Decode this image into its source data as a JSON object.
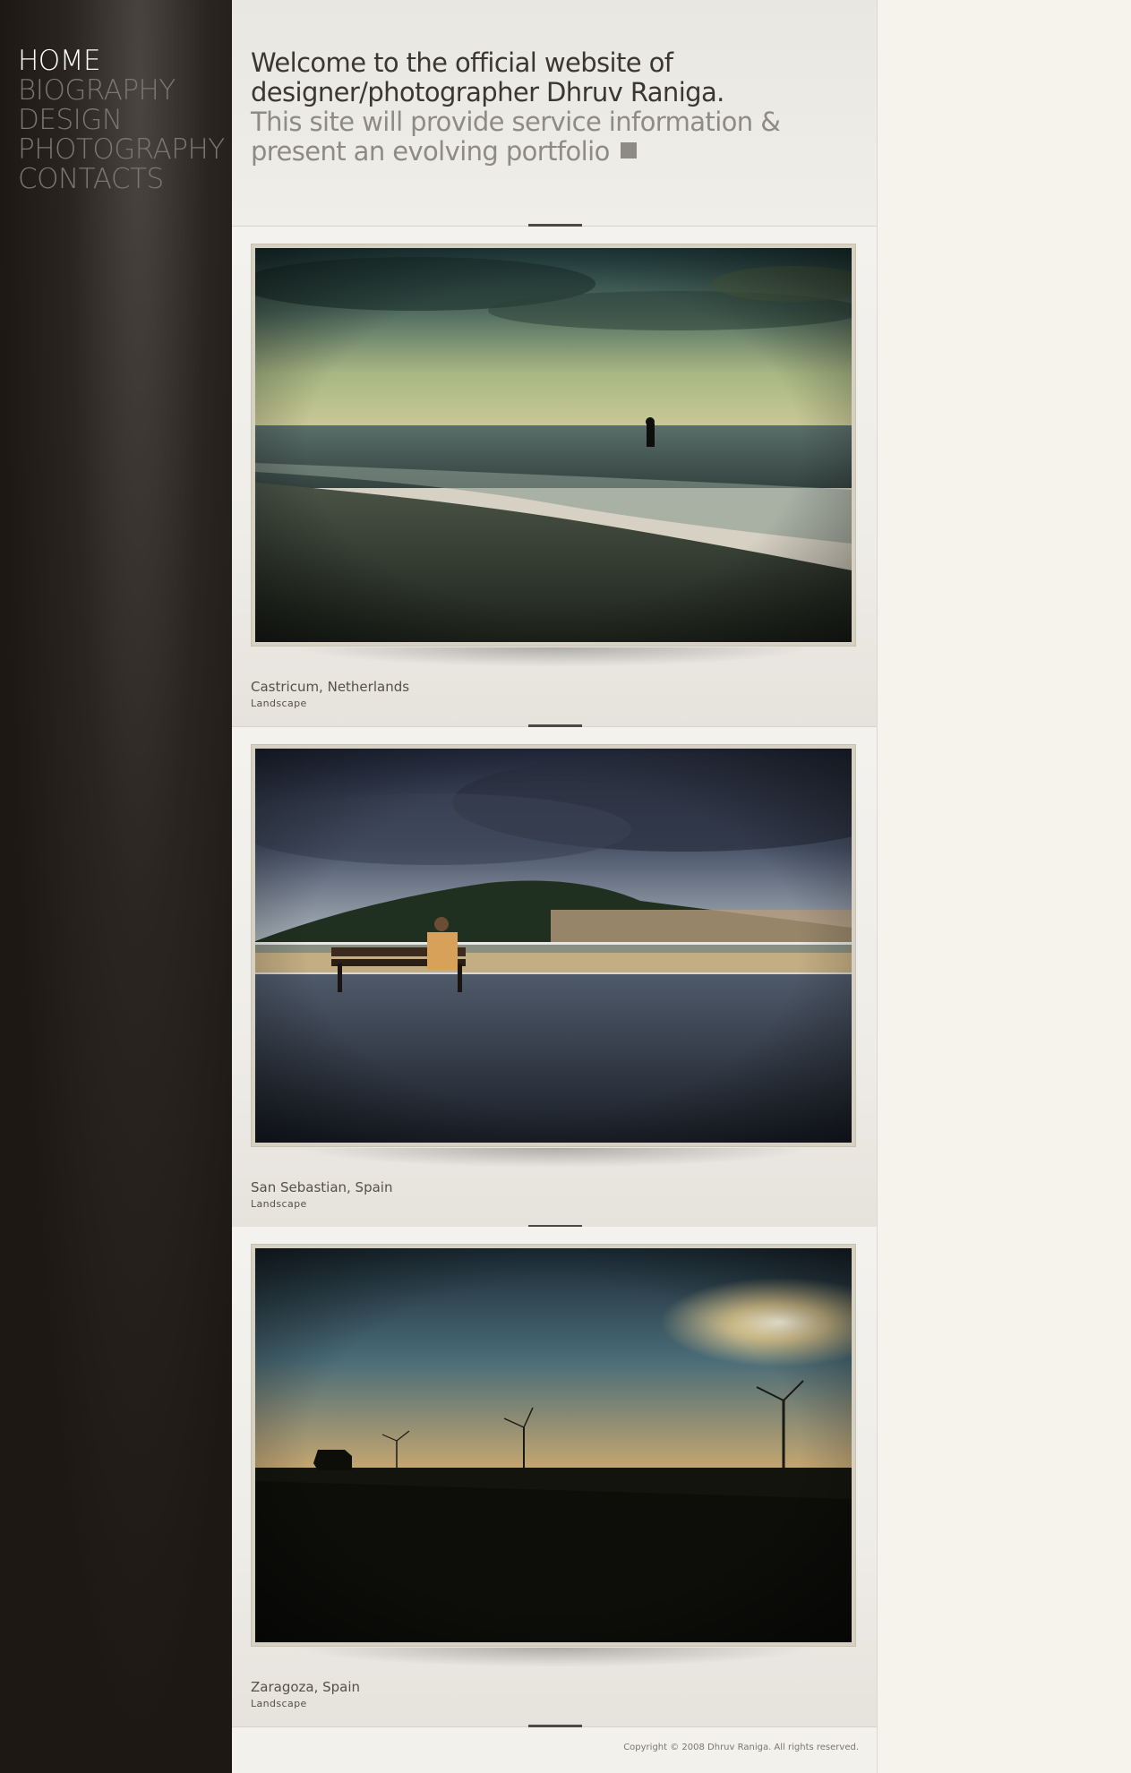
{
  "nav": {
    "items": [
      {
        "label": "HOME",
        "active": true
      },
      {
        "label": "BIOGRAPHY",
        "active": false
      },
      {
        "label": "DESIGN",
        "active": false
      },
      {
        "label": "PHOTOGRAPHY",
        "active": false
      },
      {
        "label": "CONTACTS",
        "active": false
      }
    ]
  },
  "intro": {
    "line1": "Welcome to the official website of",
    "line2": "designer/photographer Dhruv Raniga.",
    "line3": "This site will provide service information &",
    "line4": "present an evolving portfolio"
  },
  "photos": [
    {
      "title": "Castricum, Netherlands",
      "category": "Landscape"
    },
    {
      "title": "San Sebastian, Spain",
      "category": "Landscape"
    },
    {
      "title": "Zaragoza, Spain",
      "category": "Landscape"
    }
  ],
  "footer": {
    "copyright": "Copyright © 2008 Dhruv Raniga. All rights reserved."
  },
  "colors": {
    "sidebar_bg": "#1d1814",
    "nav_active": "#ffffff",
    "nav_inactive": "#7b7670",
    "page_bg": "#f6f3ec",
    "accent_square": "#8e8b85"
  }
}
